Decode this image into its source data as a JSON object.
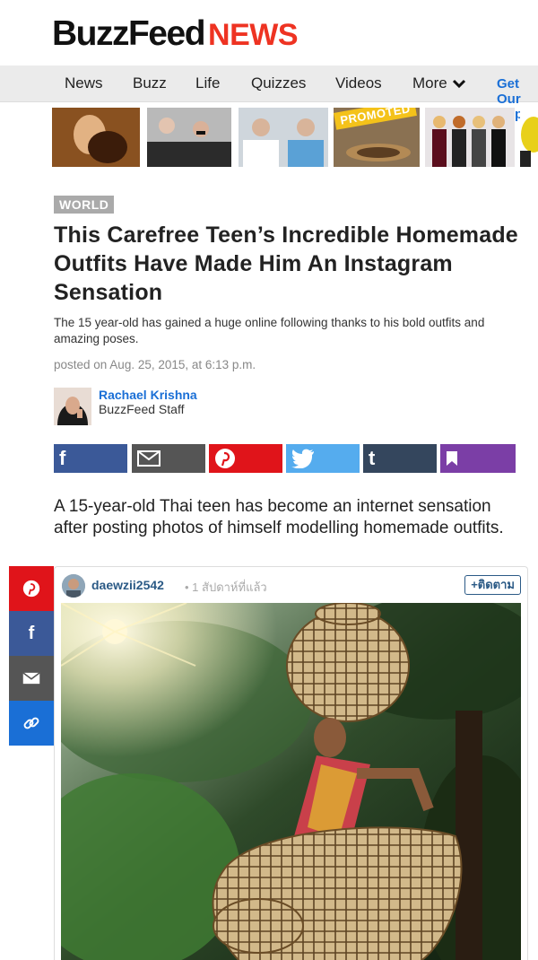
{
  "brand": {
    "name_left": "BuzzFeed",
    "name_right": "NEWS"
  },
  "nav": {
    "items": [
      "News",
      "Buzz",
      "Life",
      "Quizzes",
      "Videos"
    ],
    "more_label": "More",
    "get_app_label": "Get Our App"
  },
  "thumbs": {
    "promoted_label": "PROMOTED"
  },
  "article": {
    "badge": "WORLD",
    "title": "This Carefree Teen’s Incredible Homemade Outfits Have Made Him An Instagram Sensation",
    "subtitle": "The 15 year-old has gained a huge online following thanks to his bold outfits and amazing poses.",
    "posted": "posted on Aug. 25, 2015, at 6:13 p.m.",
    "author_name": "Rachael Krishna",
    "author_role": "BuzzFeed Staff",
    "lede": "A 15-year-old Thai teen has become an internet sensation after posting photos of himself modelling homemade outfits."
  },
  "share_buttons": [
    {
      "name": "facebook",
      "color": "#3b5998",
      "icon": "f"
    },
    {
      "name": "email",
      "color": "#555555",
      "icon": "email-icon"
    },
    {
      "name": "pinterest",
      "color": "#e0141a",
      "icon": "pinterest-icon"
    },
    {
      "name": "twitter",
      "color": "#55acee",
      "icon": "twitter-icon"
    },
    {
      "name": "tumblr",
      "color": "#34465d",
      "icon": "t"
    },
    {
      "name": "bookmark",
      "color": "#7b3ea6",
      "icon": "bookmark-icon"
    }
  ],
  "side_rail": [
    {
      "name": "pinterest",
      "color": "#e0141a"
    },
    {
      "name": "facebook",
      "color": "#3b5998"
    },
    {
      "name": "email",
      "color": "#555555"
    },
    {
      "name": "link",
      "color": "#1a6fd6"
    }
  ],
  "instagram": {
    "username": "daewzii2542",
    "time_ago": "• 1 สัปดาห์ที่แล้ว",
    "follow_label": "+ติดตาม"
  }
}
